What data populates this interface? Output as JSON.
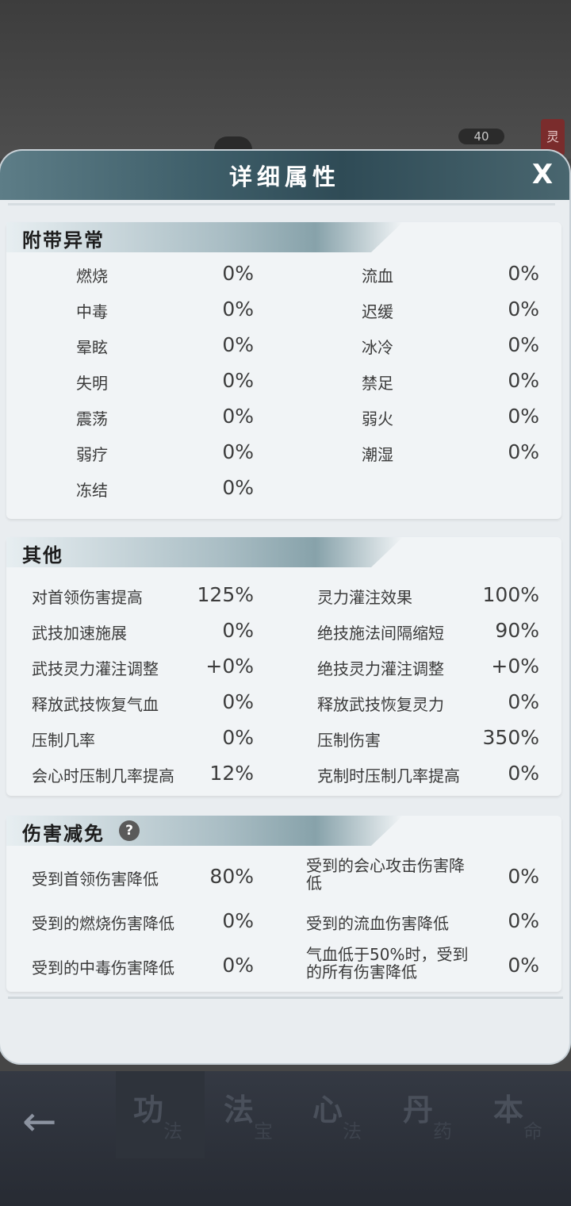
{
  "background": {
    "level_label": "40",
    "side_glyph": "灵"
  },
  "modal": {
    "title": "详细属性",
    "close_label": "X"
  },
  "sections": {
    "ailments": {
      "title": "附带异常",
      "left": [
        {
          "label": "燃烧",
          "value": "0%"
        },
        {
          "label": "中毒",
          "value": "0%"
        },
        {
          "label": "晕眩",
          "value": "0%"
        },
        {
          "label": "失明",
          "value": "0%"
        },
        {
          "label": "震荡",
          "value": "0%"
        },
        {
          "label": "弱疗",
          "value": "0%"
        },
        {
          "label": "冻结",
          "value": "0%"
        }
      ],
      "right": [
        {
          "label": "流血",
          "value": "0%"
        },
        {
          "label": "迟缓",
          "value": "0%"
        },
        {
          "label": "冰冷",
          "value": "0%"
        },
        {
          "label": "禁足",
          "value": "0%"
        },
        {
          "label": "弱火",
          "value": "0%"
        },
        {
          "label": "潮湿",
          "value": "0%"
        }
      ]
    },
    "other": {
      "title": "其他",
      "left": [
        {
          "label": "对首领伤害提高",
          "value": "125%"
        },
        {
          "label": "武技加速施展",
          "value": "0%"
        },
        {
          "label": "武技灵力灌注调整",
          "value": "+0%"
        },
        {
          "label": "释放武技恢复气血",
          "value": "0%"
        },
        {
          "label": "压制几率",
          "value": "0%"
        },
        {
          "label": "会心时压制几率提高",
          "value": "12%"
        }
      ],
      "right": [
        {
          "label": "灵力灌注效果",
          "value": "100%"
        },
        {
          "label": "绝技施法间隔缩短",
          "value": "90%"
        },
        {
          "label": "绝技灵力灌注调整",
          "value": "+0%"
        },
        {
          "label": "释放武技恢复灵力",
          "value": "0%"
        },
        {
          "label": "压制伤害",
          "value": "350%"
        },
        {
          "label": "克制时压制几率提高",
          "value": "0%"
        }
      ]
    },
    "reduction": {
      "title": "伤害减免",
      "help_label": "?",
      "left": [
        {
          "label": "受到首领伤害降低",
          "value": "80%"
        },
        {
          "label": "受到的燃烧伤害降低",
          "value": "0%"
        },
        {
          "label": "受到的中毒伤害降低",
          "value": "0%"
        }
      ],
      "right": [
        {
          "label": "受到的会心攻击伤害降低",
          "value": "0%"
        },
        {
          "label": "受到的流血伤害降低",
          "value": "0%"
        },
        {
          "label": "气血低于50%时，受到的所有伤害降低",
          "value": "0%"
        }
      ]
    }
  },
  "nav": {
    "back_label": "←",
    "tabs": [
      {
        "big": "功",
        "small": "法"
      },
      {
        "big": "法",
        "small": "宝"
      },
      {
        "big": "心",
        "small": "法"
      },
      {
        "big": "丹",
        "small": "药"
      },
      {
        "big": "本",
        "small": "命"
      }
    ]
  }
}
